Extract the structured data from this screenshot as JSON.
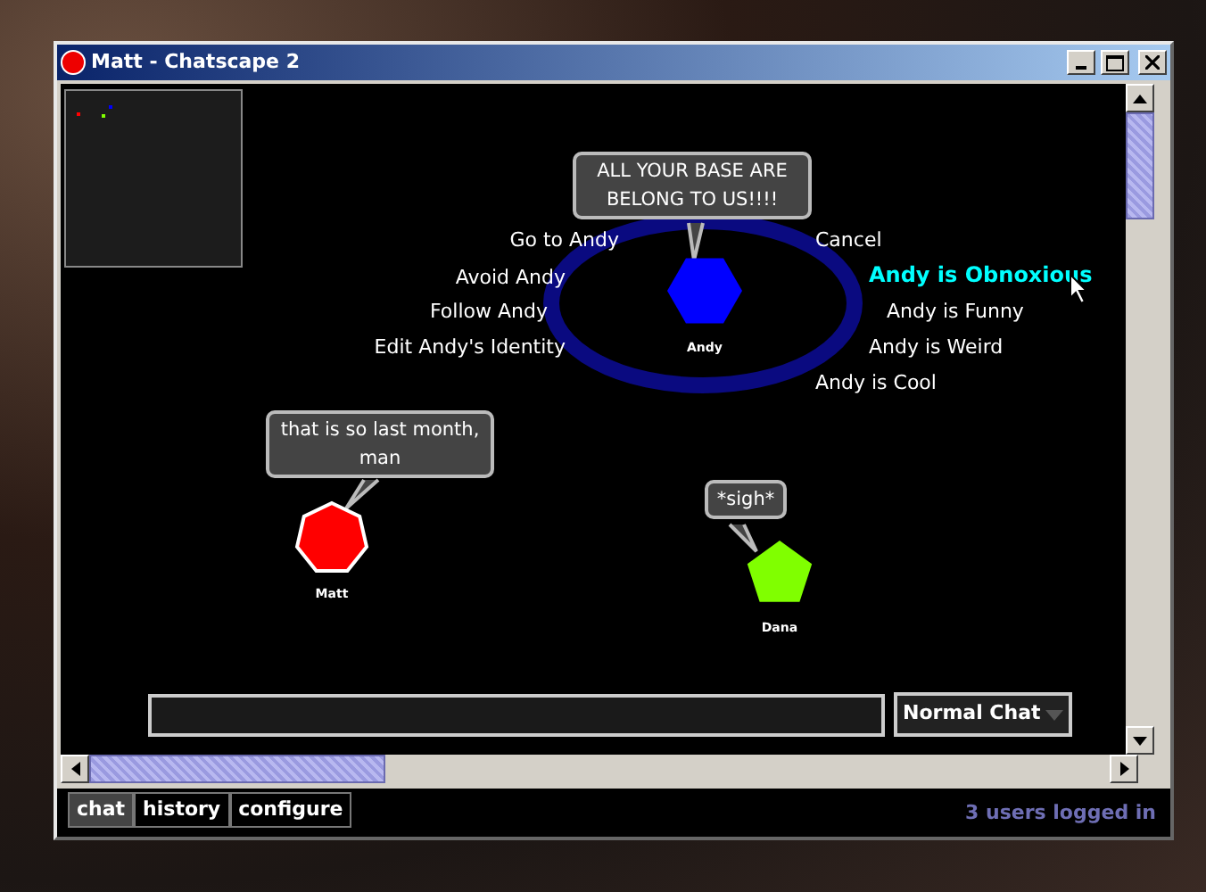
{
  "window": {
    "title": "Matt - Chatscape 2"
  },
  "minimap": {
    "dots": [
      {
        "color": "#0000ff"
      },
      {
        "color": "#ff0000"
      },
      {
        "color": "#80ff00"
      }
    ]
  },
  "users": [
    {
      "name": "Andy",
      "color": "#0000ff",
      "kind": "hexagon",
      "focused": true,
      "speech": "ALL YOUR BASE ARE BELONG TO US!!!!"
    },
    {
      "name": "Matt",
      "color": "#ff0000",
      "kind": "heptagon",
      "focused": false,
      "speech": "that is so last month, man"
    },
    {
      "name": "Dana",
      "color": "#80ff00",
      "kind": "pentagon",
      "focused": false,
      "speech": "*sigh*"
    }
  ],
  "action_menu": {
    "left": [
      {
        "label": "Go to Andy",
        "selected": false
      },
      {
        "label": "Avoid Andy",
        "selected": false
      },
      {
        "label": "Follow Andy",
        "selected": false
      },
      {
        "label": "Edit Andy's Identity",
        "selected": false
      }
    ],
    "right": [
      {
        "label": "Cancel",
        "selected": false
      },
      {
        "label": "Andy is Obnoxious",
        "selected": true
      },
      {
        "label": "Andy is Funny",
        "selected": false
      },
      {
        "label": "Andy is Weird",
        "selected": false
      },
      {
        "label": "Andy is Cool",
        "selected": false
      }
    ]
  },
  "chat_mode": {
    "value": "Normal Chat"
  },
  "tabs": [
    {
      "label": "chat",
      "selected": true
    },
    {
      "label": "history",
      "selected": false
    },
    {
      "label": "configure",
      "selected": false
    }
  ],
  "status_bar": "3 users logged in"
}
